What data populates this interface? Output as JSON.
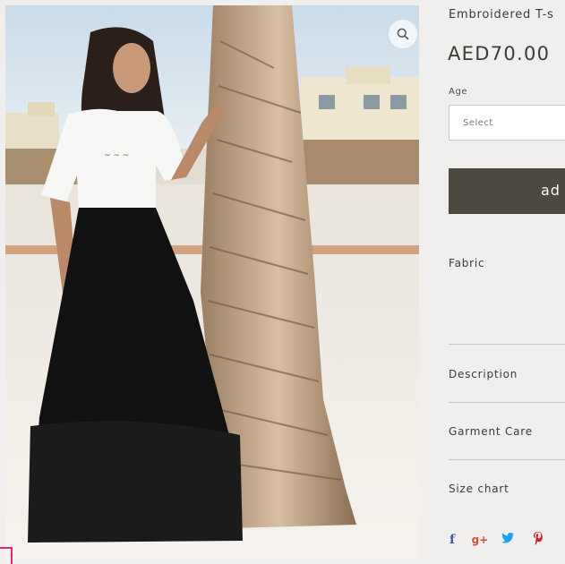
{
  "product": {
    "title": "Embroidered T-s",
    "price": "AED70.00",
    "image_alt": "Girl in embroidered white t-shirt and black tulle skirt beside a palm tree"
  },
  "options": {
    "age_label": "Age",
    "age_select_value": "Select"
  },
  "actions": {
    "add_to_cart_label": "ad"
  },
  "sections": [
    {
      "label": "Fabric"
    },
    {
      "label": "Description"
    },
    {
      "label": "Garment Care"
    },
    {
      "label": "Size chart"
    }
  ],
  "share": [
    {
      "icon": "facebook-icon",
      "glyph": "f",
      "color": "#3b5998"
    },
    {
      "icon": "google-plus-icon",
      "glyph": "g+",
      "color": "#dd4b39"
    },
    {
      "icon": "twitter-icon",
      "glyph": "t",
      "color": "#1da1f2"
    },
    {
      "icon": "pinterest-icon",
      "glyph": "p",
      "color": "#cb2027"
    }
  ],
  "colors": {
    "button_bg": "#4b4940",
    "text": "#3b3a36",
    "page_bg": "#f0efed"
  }
}
